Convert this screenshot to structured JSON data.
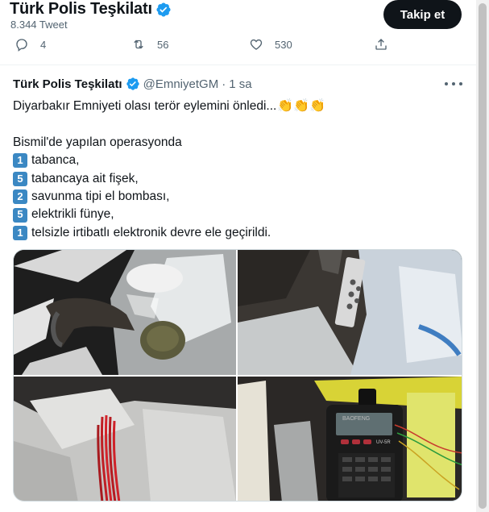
{
  "header": {
    "title": "Türk Polis Teşkilatı",
    "tweet_count": "8.344 Tweet",
    "follow_label": "Takip et"
  },
  "actions": {
    "reply_count": "4",
    "retweet_count": "56",
    "like_count": "530"
  },
  "quoted_tweet": {
    "name": "Türk Polis Teşkilatı",
    "handle": "@EmniyetGM",
    "separator": "·",
    "time": "1 sa",
    "line1": "Diyarbakır Emniyeti olası terör eylemini önledi...",
    "clap_emoji": "👏👏👏",
    "line2": "Bismil'de yapılan operasyonda",
    "items": [
      {
        "key": "1",
        "text": "tabanca,"
      },
      {
        "key": "5",
        "text": "tabancaya ait fişek,"
      },
      {
        "key": "2",
        "text": "savunma tipi el bombası,"
      },
      {
        "key": "5",
        "text": "elektrikli fünye,"
      },
      {
        "key": "1",
        "text": "telsizle irtibatlı elektronik devre ele geçirildi."
      }
    ]
  },
  "media": {
    "photos": [
      "photo-1",
      "photo-2",
      "photo-3",
      "photo-4"
    ],
    "radio_brand": "BAOFENG",
    "radio_model": "UV-5R"
  },
  "colors": {
    "accent": "#1d9bf0",
    "text_primary": "#0f1419",
    "text_secondary": "#536471",
    "follow_button_bg": "#0f1419"
  },
  "icons": [
    "verified-badge-icon",
    "reply-icon",
    "retweet-icon",
    "like-icon",
    "share-icon",
    "more-icon"
  ]
}
